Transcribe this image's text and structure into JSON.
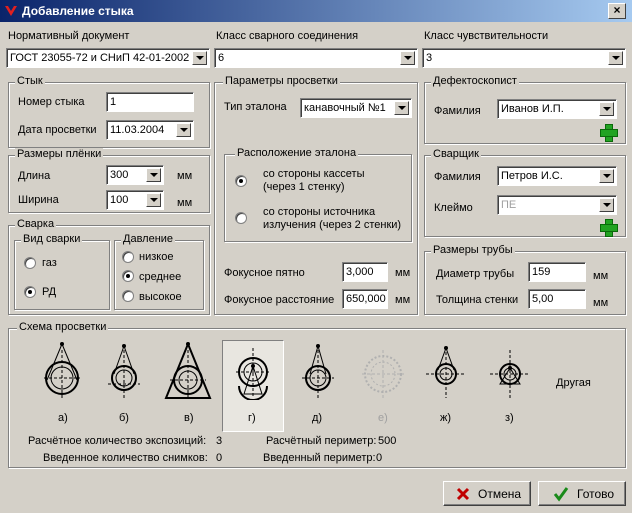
{
  "window": {
    "title": "Добавление стыка",
    "close": "×"
  },
  "top": {
    "norm_label": "Нормативный документ",
    "norm_value": "ГОСТ 23055-72 и СНиП 42-01-2002",
    "class_label": "Класс сварного соединения",
    "class_value": "6",
    "sens_label": "Класс чувствительности",
    "sens_value": "3"
  },
  "joint": {
    "legend": "Стык",
    "number_label": "Номер стыка",
    "number_value": "1",
    "date_label": "Дата просветки",
    "date_value": "11.03.2004"
  },
  "film": {
    "legend": "Размеры плёнки",
    "length_label": "Длина",
    "length_value": "300",
    "width_label": "Ширина",
    "width_value": "100",
    "unit": "мм"
  },
  "welding": {
    "legend": "Сварка",
    "type_legend": "Вид сварки",
    "gas": "газ",
    "rd": "РД",
    "pressure_legend": "Давление",
    "low": "низкое",
    "mid": "среднее",
    "high": "высокое"
  },
  "params": {
    "legend": "Параметры просветки",
    "etalon_label": "Тип эталона",
    "etalon_value": "канавочный №1",
    "placement_legend": "Расположение эталона",
    "opt1_line1": "со стороны кассеты",
    "opt1_line2": "(через 1 стенку)",
    "opt2_line1": "со стороны источника",
    "opt2_line2": "излучения  (через 2 стенки)",
    "focal_spot_label": "Фокусное пятно",
    "focal_spot_value": "3,000",
    "focal_dist_label": "Фокусное расстояние",
    "focal_dist_value": "650,000",
    "unit": "мм"
  },
  "inspector": {
    "legend": "Дефектоскопист",
    "surname_label": "Фамилия",
    "surname_value": "Иванов И.П."
  },
  "welder": {
    "legend": "Сварщик",
    "surname_label": "Фамилия",
    "surname_value": "Петров И.С.",
    "stamp_label": "Клеймо",
    "stamp_value": "ПЕ"
  },
  "pipe": {
    "legend": "Размеры трубы",
    "diameter_label": "Диаметр трубы",
    "diameter_value": "159",
    "wall_label": "Толщина стенки",
    "wall_value": "5,00",
    "unit": "мм"
  },
  "scheme": {
    "legend": "Схема просветки",
    "labels": [
      "а)",
      "б)",
      "в)",
      "г)",
      "д)",
      "е)",
      "ж)",
      "з)"
    ],
    "other": "Другая",
    "calc_exp_label": "Расчётное количество экспозиций:",
    "calc_exp_value": "3",
    "entered_label": "Введенное количество снимков:",
    "entered_value": "0",
    "calc_per_label": "Расчётный периметр:",
    "calc_per_value": "500",
    "entered_per_label": "Введенный периметр:",
    "entered_per_value": "0"
  },
  "buttons": {
    "cancel": "Отмена",
    "ok": "Готово"
  }
}
